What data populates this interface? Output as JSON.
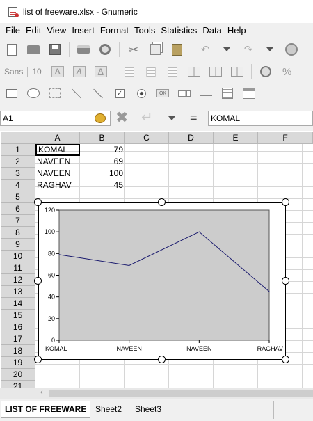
{
  "window": {
    "title": "list of freeware.xlsx - Gnumeric"
  },
  "menu": [
    "File",
    "Edit",
    "View",
    "Insert",
    "Format",
    "Tools",
    "Statistics",
    "Data",
    "Help"
  ],
  "format_toolbar": {
    "font_name": "Sans",
    "font_size": "10",
    "bold": "A",
    "italic": "A",
    "underline": "A"
  },
  "formula_bar": {
    "cell_ref": "A1",
    "content": "KOMAL",
    "equals": "="
  },
  "grid": {
    "columns": [
      "A",
      "B",
      "C",
      "D",
      "E",
      "F"
    ],
    "rows": [
      "1",
      "2",
      "3",
      "4",
      "5",
      "6",
      "7",
      "8",
      "9",
      "10",
      "11",
      "12",
      "13",
      "14",
      "15",
      "16",
      "17",
      "18",
      "19",
      "20",
      "21"
    ],
    "data": [
      [
        "KOMAL",
        "79"
      ],
      [
        "NAVEEN",
        "69"
      ],
      [
        "NAVEEN",
        "100"
      ],
      [
        "RAGHAV",
        "45"
      ]
    ]
  },
  "chart_data": {
    "type": "line",
    "categories": [
      "KOMAL",
      "NAVEEN",
      "NAVEEN",
      "RAGHAV"
    ],
    "series": [
      {
        "values": [
          79,
          69,
          100,
          45
        ],
        "color": "#1a1a6e"
      }
    ],
    "ylim": [
      0,
      120
    ],
    "yticks": [
      0,
      20,
      40,
      60,
      80,
      100,
      120
    ],
    "plot_background": "#cccccc",
    "grid": false,
    "legend": "none"
  },
  "sheet_tabs": [
    "LIST OF FREEWARE",
    "Sheet2",
    "Sheet3"
  ],
  "active_tab": "LIST OF FREEWARE",
  "scroll": {
    "left_arrow": "‹"
  }
}
